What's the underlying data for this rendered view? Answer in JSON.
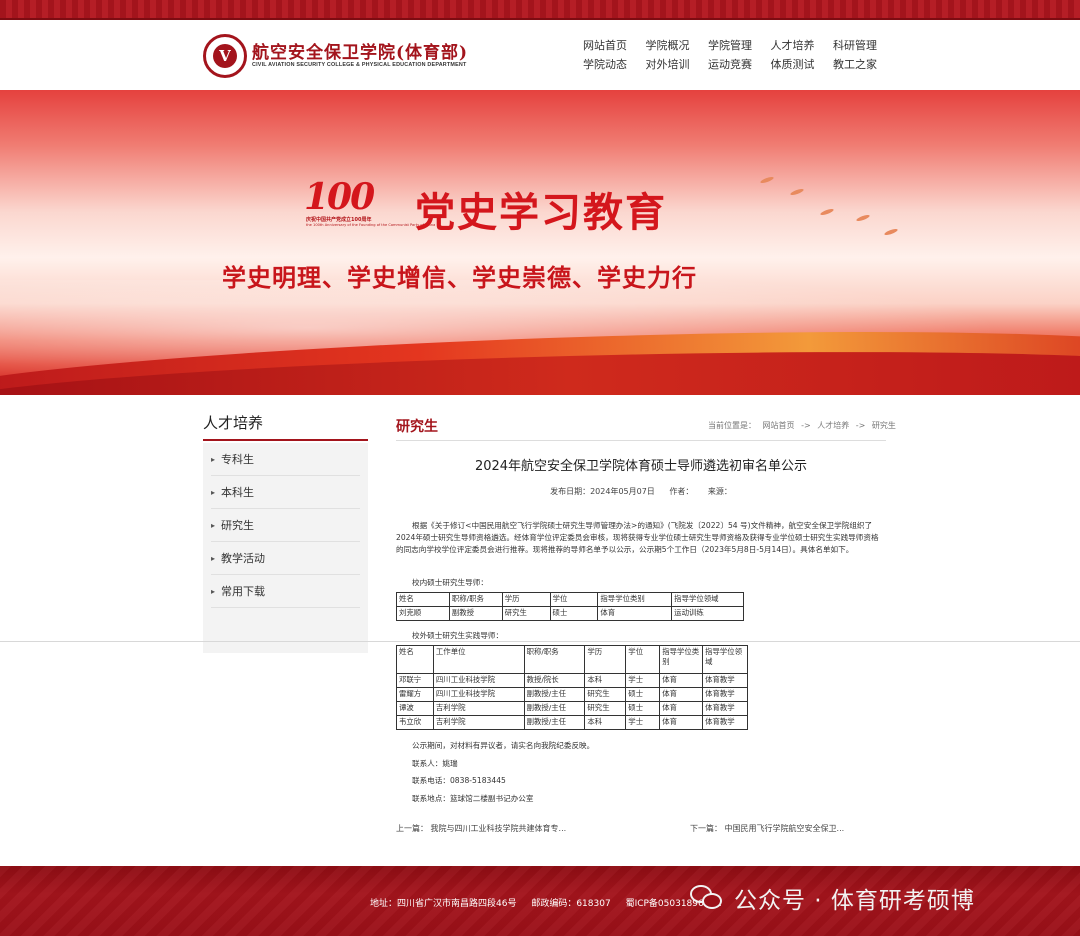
{
  "header": {
    "logo_cn": "航空安全保卫学院(体育部)",
    "logo_en": "CIVIL AVIATION SECURITY COLLEGE & PHYSICAL EDUCATION DEPARTMENT",
    "nav": [
      "网站首页",
      "学院概况",
      "学院管理",
      "人才培养",
      "科研管理",
      "学院动态",
      "对外培训",
      "运动竞赛",
      "体质测试",
      "教工之家"
    ]
  },
  "banner": {
    "badge_num": "100",
    "badge_caption": "庆祝中国共产党成立100周年",
    "badge_caption_en": "the 100th Anniversary of the Founding of the Communist Party of China",
    "title": "党史学习教育",
    "subtitle": "学史明理、学史增信、学史崇德、学史力行"
  },
  "sidebar": {
    "title": "人才培养",
    "items": [
      "专科生",
      "本科生",
      "研究生",
      "教学活动",
      "常用下载"
    ]
  },
  "section": {
    "title": "研究生",
    "breadcrumb": [
      "当前位置是：",
      "网站首页",
      "->",
      "人才培养",
      "->",
      "研究生"
    ]
  },
  "article": {
    "title": "2024年航空安全保卫学院体育硕士导师遴选初审名单公示",
    "date": "发布日期：2024年05月07日",
    "author": "作者：",
    "source": "来源：",
    "paragraph": "根据《关于修订<中国民用航空飞行学院硕士研究生导师管理办法>的通知》(飞院发〔2022〕54 号)文件精神，航空安全保卫学院组织了2024年硕士研究生导师资格遴选。经体育学位评定委员会审核，现将获得专业学位硕士研究生导师资格及获得专业学位硕士研究生实践导师资格的同志向学校学位评定委员会进行推荐。现将推荐的导师名单予以公示，公示期5个工作日（2023年5月8日-5月14日）。具体名单如下。",
    "table1_label": "校内硕士研究生导师：",
    "table1_headers": [
      "姓名",
      "职称/职务",
      "学历",
      "学位",
      "指导学位类别",
      "指导学位领域"
    ],
    "table1_rows": [
      [
        "刘克顺",
        "副教授",
        "研究生",
        "硕士",
        "体育",
        "运动训练"
      ]
    ],
    "table2_label": "校外硕士研究生实践导师：",
    "table2_headers": [
      "姓名",
      "工作单位",
      "职称/职务",
      "学历",
      "学位",
      "指导学位类别",
      "指导学位领域"
    ],
    "table2_rows": [
      [
        "邓联宁",
        "四川工业科技学院",
        "教授/院长",
        "本科",
        "学士",
        "体育",
        "体育教学"
      ],
      [
        "雷耀方",
        "四川工业科技学院",
        "副教授/主任",
        "研究生",
        "硕士",
        "体育",
        "体育教学"
      ],
      [
        "谭波",
        "吉利学院",
        "副教授/主任",
        "研究生",
        "硕士",
        "体育",
        "体育教学"
      ],
      [
        "韦立欣",
        "吉利学院",
        "副教授/主任",
        "本科",
        "学士",
        "体育",
        "体育教学"
      ]
    ],
    "notice": "公示期间，对材料有异议者，请实名向我院纪委反映。",
    "contact": "联系人：姚瑞",
    "phone": "联系电话：0838-5183445",
    "address": "联系地点：篮球馆二楼副书记办公室",
    "prev": "上一篇：  我院与四川工业科技学院共建体育专...",
    "next": "下一篇：  中国民用飞行学院航空安全保卫..."
  },
  "footer": {
    "address": "地址：四川省广汉市南昌路四段46号",
    "postcode": "邮政编码：618307",
    "icp": "蜀ICP备05031896号-1",
    "watermark": "公众号 · 体育研考硕博"
  },
  "colors": {
    "brand": "#a3141c",
    "banner_red": "#d4161c"
  }
}
